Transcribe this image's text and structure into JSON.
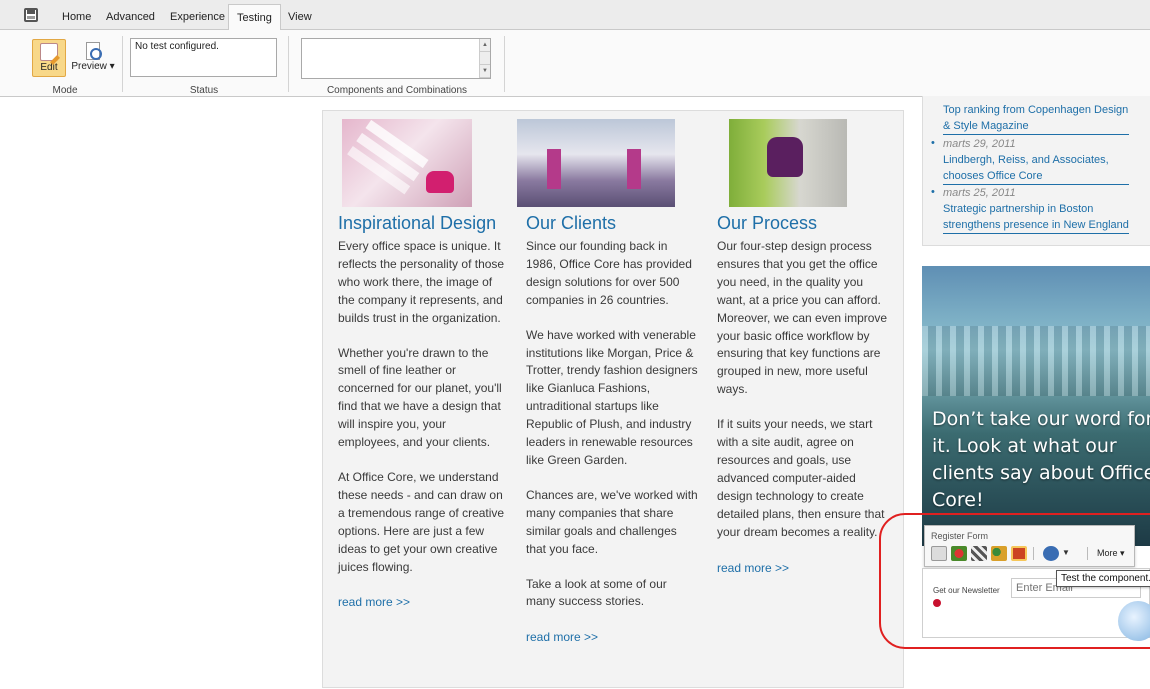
{
  "ribbon": {
    "tabs": [
      "Home",
      "Advanced",
      "Experience",
      "Testing",
      "View"
    ],
    "active_tab": "Testing",
    "groups": {
      "mode": {
        "label": "Mode",
        "edit_label": "Edit",
        "preview_label": "Preview ▾"
      },
      "status": {
        "label": "Status",
        "text": "No test configured."
      },
      "components": {
        "label": "Components and Combinations"
      }
    }
  },
  "columns": [
    {
      "title": "Inspirational Design",
      "paragraphs": [
        "Every office space is unique. It reflects the personality of those who work there, the image of the company it represents, and builds trust in the organization.",
        "Whether you're drawn to the smell of fine leather or concerned for our planet, you'll find that we have a design that will inspire you, your employees, and your clients.",
        "At Office Core, we understand these needs - and can draw on a tremendous range of creative options. Here are just a few ideas to get your own creative juices flowing."
      ],
      "read_more": "read more >>"
    },
    {
      "title": "Our Clients",
      "paragraphs": [
        "Since our founding back in 1986, Office Core has provided design solutions for over 500 companies in 26 countries.",
        "We have worked with venerable institutions like Morgan, Price & Trotter, trendy fashion designers like Gianluca Fashions, untraditional startups like Republic of Plush, and industry leaders in renewable resources like Green Garden.",
        "Chances are, we've worked with many companies that share similar goals and challenges that you face.",
        "Take a look at some of our many success stories."
      ],
      "read_more": "read more >>"
    },
    {
      "title": "Our Process",
      "paragraphs": [
        "Our four-step design process ensures that you get the office you need, in the quality you want, at a price you can afford. Moreover, we can even improve your basic office workflow by ensuring that key functions are grouped in new, more useful ways.",
        "If it suits your needs, we start with a site audit, agree on resources and goals, use advanced computer-aided design technology to create detailed plans, then ensure that your dream becomes a reality."
      ],
      "read_more": "read more >>"
    }
  ],
  "news": {
    "items": [
      {
        "date": "",
        "link": "Top ranking from Copenhagen Design & Style Magazine"
      },
      {
        "date": "marts 29, 2011",
        "link": "Lindbergh, Reiss, and Associates, chooses Office Core"
      },
      {
        "date": "marts 25, 2011",
        "link": "Strategic partnership in Boston strengthens presence in New England"
      }
    ]
  },
  "promo": {
    "text": "Don’t take our word for it. Look at what our clients say about Office Core!"
  },
  "component_toolbar": {
    "title": "Register Form",
    "more_label": "More ▾",
    "tooltip": "Test the component."
  },
  "newsletter": {
    "label": "Get our Newsletter",
    "placeholder": "Enter Email"
  },
  "colors": {
    "link": "#1e6fa8",
    "highlight": "#e02020",
    "edit_active": "#f8d889"
  }
}
